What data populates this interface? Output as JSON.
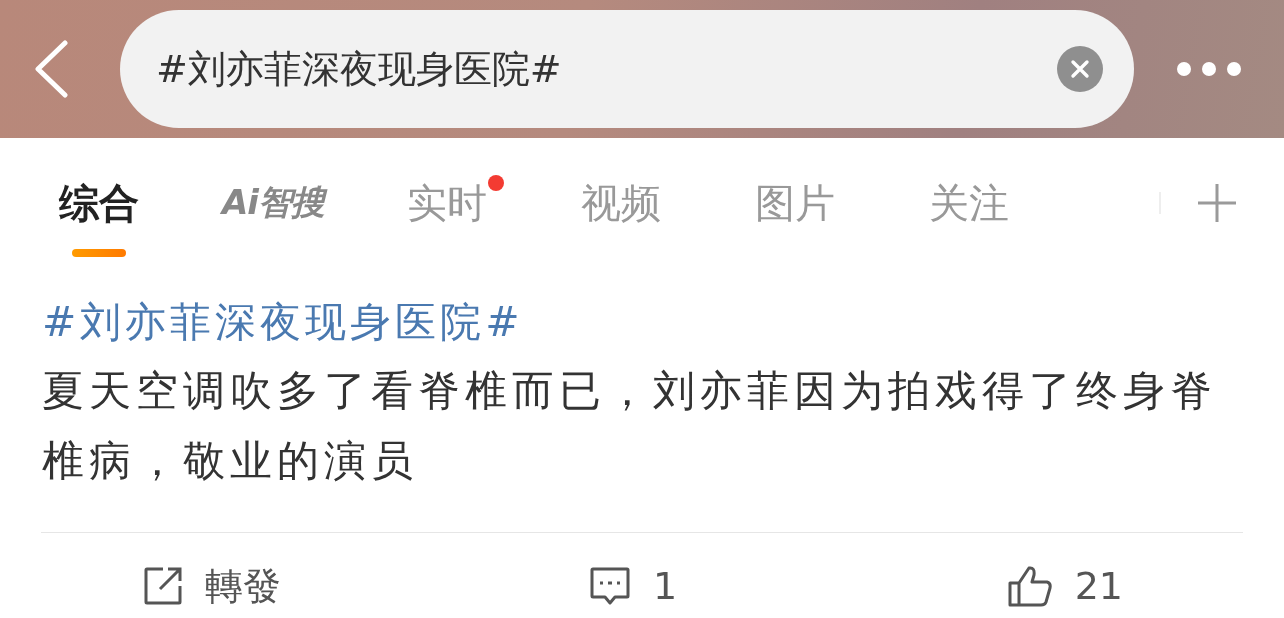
{
  "search": {
    "value": "#刘亦菲深夜现身医院#"
  },
  "tabs": [
    {
      "label": "综合",
      "selected": true,
      "kind": "text",
      "dot": false
    },
    {
      "label": "Ai智搜",
      "selected": false,
      "kind": "logo",
      "dot": false
    },
    {
      "label": "实时",
      "selected": false,
      "kind": "text",
      "dot": true
    },
    {
      "label": "视频",
      "selected": false,
      "kind": "text",
      "dot": false
    },
    {
      "label": "图片",
      "selected": false,
      "kind": "text",
      "dot": false
    },
    {
      "label": "关注",
      "selected": false,
      "kind": "text",
      "dot": false
    }
  ],
  "post": {
    "hashtag": "#刘亦菲深夜现身医院#",
    "text": "夏天空调吹多了看脊椎而已，刘亦菲因为拍戏得了终身脊椎病，敬业的演员"
  },
  "actions": [
    {
      "kind": "repost",
      "label": "轉發"
    },
    {
      "kind": "comment",
      "label": "1"
    },
    {
      "kind": "like",
      "label": "21"
    }
  ]
}
